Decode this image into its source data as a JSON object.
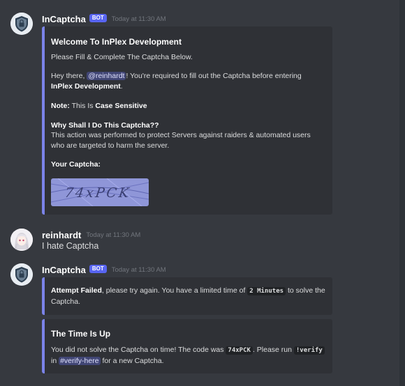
{
  "messages": [
    {
      "author": "InCaptcha",
      "bot_tag": "BOT",
      "timestamp": "Today at 11:30 AM",
      "embed": {
        "title": "Welcome To InPlex Development",
        "line1": "Please Fill & Complete The Captcha Below.",
        "hey": "Hey there, ",
        "mention": "@reinhardt",
        "hey_rest": "! You're required to fill out the Captcha before entering",
        "server_name": "InPlex Development",
        "period": ".",
        "note_label": "Note:",
        "note_text": " This Is ",
        "note_bold": "Case Sensitive",
        "why_title": "Why Shall I Do This Captcha??",
        "why_line1": "This action was performed to protect Servers against raiders & automated users",
        "why_line2": "who are targeted to harm the server.",
        "your_captcha": "Your Captcha:",
        "captcha_text": "74xPCK"
      }
    },
    {
      "author": "reinhardt",
      "timestamp": "Today at 11:30 AM",
      "text": "I hate Captcha"
    },
    {
      "author": "InCaptcha",
      "bot_tag": "BOT",
      "timestamp": "Today at 11:30 AM",
      "embed1": {
        "bold": "Attempt Failed",
        "text": ", please try again. You have a limited time of ",
        "code": "2 Minutes",
        "text2": " to solve the",
        "line2": "Captcha."
      },
      "embed2": {
        "title": "The Time Is Up",
        "text": "You did not solve the Captcha on time! The code was ",
        "code": "74xPCK",
        "text2": ". Please run ",
        "command": "!verify",
        "in": "in ",
        "channel": "#verify-here",
        "text3": " for a new Captcha."
      }
    }
  ],
  "colors": {
    "background": "#36393f",
    "embed_bg": "#2f3136",
    "embed_border": "#7b83e8",
    "bot_tag": "#5865f2"
  }
}
